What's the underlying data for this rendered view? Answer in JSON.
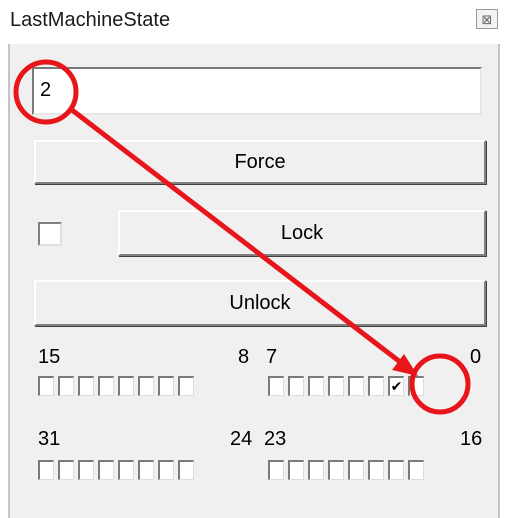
{
  "window": {
    "title": "LastMachineState",
    "close_glyph": "⊠"
  },
  "value_field": {
    "value": "2"
  },
  "buttons": {
    "force": "Force",
    "lock": "Lock",
    "unlock": "Unlock"
  },
  "lock_checkbox": {
    "checked": false
  },
  "bit_labels": {
    "b15": "15",
    "b8": "8",
    "b7": "7",
    "b0": "0",
    "b31": "31",
    "b24": "24",
    "b23": "23",
    "b16": "16"
  },
  "bits": {
    "15_8": [
      false,
      false,
      false,
      false,
      false,
      false,
      false,
      false
    ],
    "7_0": [
      false,
      false,
      false,
      false,
      false,
      false,
      true,
      false
    ],
    "31_24": [
      false,
      false,
      false,
      false,
      false,
      false,
      false,
      false
    ],
    "23_16": [
      false,
      false,
      false,
      false,
      false,
      false,
      false,
      false
    ]
  },
  "annotation": {
    "color": "#e8161b"
  }
}
